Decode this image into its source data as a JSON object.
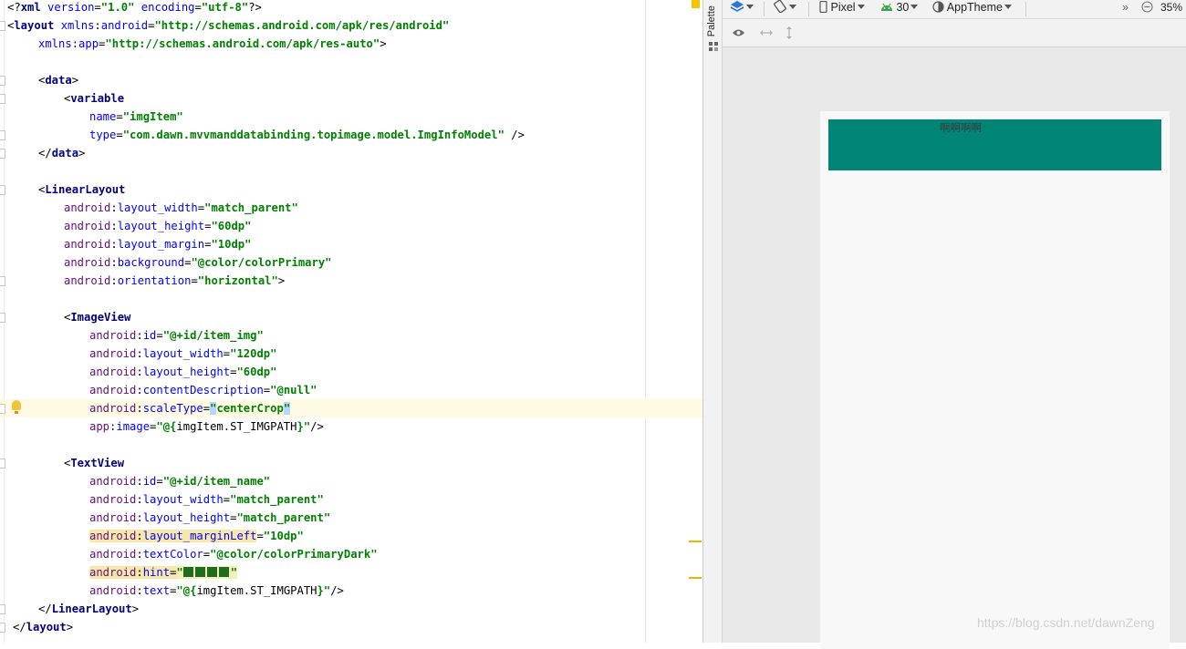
{
  "editor": {
    "lines": [
      {
        "segs": [
          [
            "p",
            "<?"
          ],
          [
            "tag",
            "xml "
          ],
          [
            "attr",
            "version"
          ],
          [
            "p",
            "="
          ],
          [
            "val",
            "\"1.0\""
          ],
          [
            "p",
            " "
          ],
          [
            "attr",
            "encoding"
          ],
          [
            "p",
            "="
          ],
          [
            "val",
            "\"utf-8\""
          ],
          [
            "p",
            "?>"
          ]
        ],
        "indent": 0
      },
      {
        "segs": [
          [
            "p",
            "<"
          ],
          [
            "tag",
            "layout "
          ],
          [
            "attr",
            "xmlns"
          ],
          [
            "p",
            ":"
          ],
          [
            "attr",
            "android"
          ],
          [
            "p",
            "="
          ],
          [
            "val",
            "\"http://schemas.android.com/apk/res/android\""
          ]
        ],
        "indent": 0
      },
      {
        "segs": [
          [
            "attr",
            "xmlns"
          ],
          [
            "p",
            ":"
          ],
          [
            "attr",
            "app"
          ],
          [
            "p",
            "="
          ],
          [
            "val",
            "\"http://schemas.android.com/apk/res-auto\""
          ],
          [
            "p",
            ">"
          ]
        ],
        "indent": 34
      },
      {
        "segs": [],
        "indent": 0
      },
      {
        "segs": [
          [
            "p",
            "<"
          ],
          [
            "tag",
            "data"
          ],
          [
            "p",
            ">"
          ]
        ],
        "indent": 34
      },
      {
        "segs": [
          [
            "p",
            "<"
          ],
          [
            "tag",
            "variable"
          ]
        ],
        "indent": 62
      },
      {
        "segs": [
          [
            "attr",
            "name"
          ],
          [
            "p",
            "="
          ],
          [
            "val",
            "\"imgItem\""
          ]
        ],
        "indent": 90
      },
      {
        "segs": [
          [
            "attr",
            "type"
          ],
          [
            "p",
            "="
          ],
          [
            "val",
            "\"com.dawn.mvvmanddatabinding.topimage.model.ImgInfoModel\""
          ],
          [
            "p",
            " />"
          ]
        ],
        "indent": 90
      },
      {
        "segs": [
          [
            "p",
            "</"
          ],
          [
            "tag",
            "data"
          ],
          [
            "p",
            ">"
          ]
        ],
        "indent": 34
      },
      {
        "segs": [],
        "indent": 0
      },
      {
        "segs": [
          [
            "p",
            "<"
          ],
          [
            "tag",
            "LinearLayout"
          ]
        ],
        "indent": 34
      },
      {
        "segs": [
          [
            "ns",
            "android"
          ],
          [
            "p",
            ":"
          ],
          [
            "attr",
            "layout_width"
          ],
          [
            "p",
            "="
          ],
          [
            "val",
            "\"match_parent\""
          ]
        ],
        "indent": 62
      },
      {
        "segs": [
          [
            "ns",
            "android"
          ],
          [
            "p",
            ":"
          ],
          [
            "attr",
            "layout_height"
          ],
          [
            "p",
            "="
          ],
          [
            "val",
            "\"60dp\""
          ]
        ],
        "indent": 62
      },
      {
        "segs": [
          [
            "ns",
            "android"
          ],
          [
            "p",
            ":"
          ],
          [
            "attr",
            "layout_margin"
          ],
          [
            "p",
            "="
          ],
          [
            "val",
            "\"10dp\""
          ]
        ],
        "indent": 62
      },
      {
        "segs": [
          [
            "ns",
            "android"
          ],
          [
            "p",
            ":"
          ],
          [
            "attr",
            "background"
          ],
          [
            "p",
            "="
          ],
          [
            "val",
            "\"@color/colorPrimary\""
          ]
        ],
        "indent": 62
      },
      {
        "segs": [
          [
            "ns",
            "android"
          ],
          [
            "p",
            ":"
          ],
          [
            "attr",
            "orientation"
          ],
          [
            "p",
            "="
          ],
          [
            "val",
            "\"horizontal\""
          ],
          [
            "p",
            ">"
          ]
        ],
        "indent": 62
      },
      {
        "segs": [],
        "indent": 0
      },
      {
        "segs": [
          [
            "p",
            "<"
          ],
          [
            "tag",
            "ImageView"
          ]
        ],
        "indent": 62
      },
      {
        "segs": [
          [
            "ns",
            "android"
          ],
          [
            "p",
            ":"
          ],
          [
            "attr",
            "id"
          ],
          [
            "p",
            "="
          ],
          [
            "val",
            "\"@+id/item_img\""
          ]
        ],
        "indent": 90
      },
      {
        "segs": [
          [
            "ns",
            "android"
          ],
          [
            "p",
            ":"
          ],
          [
            "attr",
            "layout_width"
          ],
          [
            "p",
            "="
          ],
          [
            "val",
            "\"120dp\""
          ]
        ],
        "indent": 90
      },
      {
        "segs": [
          [
            "ns",
            "android"
          ],
          [
            "p",
            ":"
          ],
          [
            "attr",
            "layout_height"
          ],
          [
            "p",
            "="
          ],
          [
            "val",
            "\"60dp\""
          ]
        ],
        "indent": 90
      },
      {
        "segs": [
          [
            "ns",
            "android"
          ],
          [
            "p",
            ":"
          ],
          [
            "attr",
            "contentDescription"
          ],
          [
            "p",
            "="
          ],
          [
            "val",
            "\"@null\""
          ]
        ],
        "indent": 90
      },
      {
        "segs": [
          [
            "ns",
            "android"
          ],
          [
            "p",
            ":"
          ],
          [
            "attr",
            "scaleType"
          ],
          [
            "p",
            "="
          ],
          [
            "caret",
            "\""
          ],
          [
            "val",
            "centerCrop"
          ],
          [
            "caret",
            "\""
          ]
        ],
        "indent": 90,
        "current": true,
        "bulb": true
      },
      {
        "segs": [
          [
            "ns",
            "app"
          ],
          [
            "p",
            ":"
          ],
          [
            "attr",
            "image"
          ],
          [
            "p",
            "="
          ],
          [
            "val",
            "\"@{"
          ],
          [
            "p",
            "imgItem.ST_IMGPATH"
          ],
          [
            "val",
            "}\""
          ],
          [
            "p",
            "/>"
          ]
        ],
        "indent": 90
      },
      {
        "segs": [],
        "indent": 0
      },
      {
        "segs": [
          [
            "p",
            "<"
          ],
          [
            "tag",
            "TextView"
          ]
        ],
        "indent": 62
      },
      {
        "segs": [
          [
            "ns",
            "android"
          ],
          [
            "p",
            ":"
          ],
          [
            "attr",
            "id"
          ],
          [
            "p",
            "="
          ],
          [
            "val",
            "\"@+id/item_name\""
          ]
        ],
        "indent": 90
      },
      {
        "segs": [
          [
            "ns",
            "android"
          ],
          [
            "p",
            ":"
          ],
          [
            "attr",
            "layout_width"
          ],
          [
            "p",
            "="
          ],
          [
            "val",
            "\"match_parent\""
          ]
        ],
        "indent": 90
      },
      {
        "segs": [
          [
            "ns",
            "android"
          ],
          [
            "p",
            ":"
          ],
          [
            "attr",
            "layout_height"
          ],
          [
            "p",
            "="
          ],
          [
            "val",
            "\"match_parent\""
          ]
        ],
        "indent": 90
      },
      {
        "segs": [
          [
            "hns",
            "android"
          ],
          [
            "hp",
            ":"
          ],
          [
            "hattr",
            "layout_marginLeft"
          ],
          [
            "p",
            "="
          ],
          [
            "val",
            "\"10dp\""
          ]
        ],
        "indent": 90
      },
      {
        "segs": [
          [
            "ns",
            "android"
          ],
          [
            "p",
            ":"
          ],
          [
            "attr",
            "textColor"
          ],
          [
            "p",
            "="
          ],
          [
            "val",
            "\"@color/colorPrimaryDark\""
          ]
        ],
        "indent": 90
      },
      {
        "segs": [
          [
            "hns",
            "android"
          ],
          [
            "hp",
            ":"
          ],
          [
            "hattr",
            "hint"
          ],
          [
            "hp",
            "="
          ],
          [
            "hval",
            "\""
          ],
          [
            "chips",
            "4"
          ],
          [
            "hval",
            "\""
          ]
        ],
        "indent": 90
      },
      {
        "segs": [
          [
            "ns",
            "android"
          ],
          [
            "p",
            ":"
          ],
          [
            "attr",
            "text"
          ],
          [
            "p",
            "="
          ],
          [
            "val",
            "\"@{"
          ],
          [
            "p",
            "imgItem.ST_IMGPATH"
          ],
          [
            "val",
            "}\""
          ],
          [
            "p",
            "/>"
          ]
        ],
        "indent": 90
      },
      {
        "segs": [
          [
            "p",
            "</"
          ],
          [
            "tag",
            "LinearLayout"
          ],
          [
            "p",
            ">"
          ]
        ],
        "indent": 34
      },
      {
        "segs": [
          [
            "p",
            "</"
          ],
          [
            "tag",
            "layout"
          ],
          [
            "p",
            ">"
          ]
        ],
        "indent": 6
      }
    ]
  },
  "palette": {
    "label": "Palette"
  },
  "toolbar": {
    "device": "Pixel",
    "api": "30",
    "theme": "AppTheme",
    "overflow": "»",
    "zoom": "35%"
  },
  "preview": {
    "hint_text": "啊啊啊啊",
    "background_color": "#008577"
  },
  "watermark": "https://blog.csdn.net/dawnZeng"
}
